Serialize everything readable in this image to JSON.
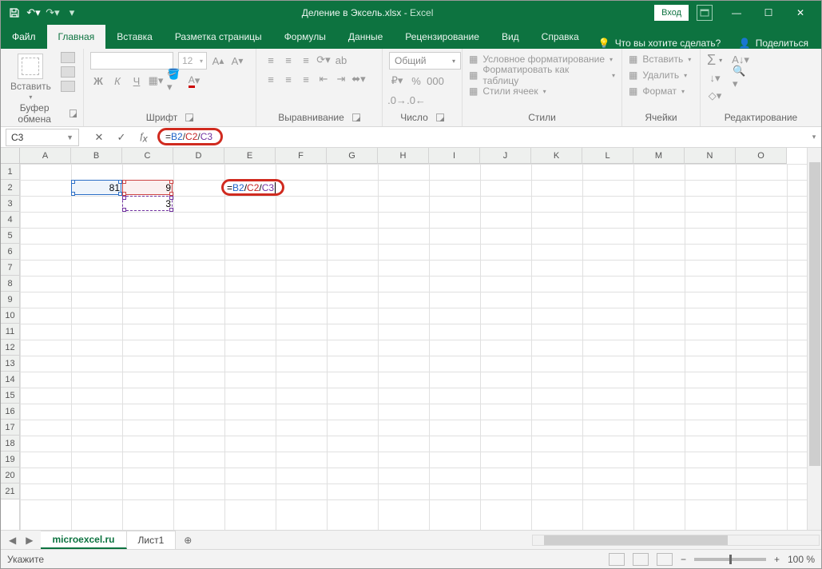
{
  "title": {
    "doc": "Деление в Эксель.xlsx",
    "sep": " - ",
    "app": "Excel"
  },
  "signin": "Вход",
  "tabs": {
    "file": "Файл",
    "home": "Главная",
    "insert": "Вставка",
    "layout": "Разметка страницы",
    "formulas": "Формулы",
    "data": "Данные",
    "review": "Рецензирование",
    "view": "Вид",
    "help": "Справка",
    "tell": "Что вы хотите сделать?",
    "share": "Поделиться"
  },
  "groups": {
    "clipboard": "Буфер обмена",
    "font": "Шрифт",
    "align": "Выравнивание",
    "number": "Число",
    "styles": "Стили",
    "cells": "Ячейки",
    "editing": "Редактирование"
  },
  "clipboard": {
    "paste": "Вставить"
  },
  "font": {
    "size": "12",
    "bold": "Ж",
    "italic": "К",
    "underline": "Ч"
  },
  "number": {
    "format": "Общий"
  },
  "styles": {
    "cond": "Условное форматирование",
    "table": "Форматировать как таблицу",
    "cell": "Стили ячеек"
  },
  "cells": {
    "insert": "Вставить",
    "delete": "Удалить",
    "format": "Формат"
  },
  "namebox": "C3",
  "formula": {
    "eq": "=",
    "b2": "B2",
    "s1": "/",
    "c2": "C2",
    "s2": "/",
    "c3": "C3"
  },
  "columns": [
    "A",
    "B",
    "C",
    "D",
    "E",
    "F",
    "G",
    "H",
    "I",
    "J",
    "K",
    "L",
    "M",
    "N",
    "O"
  ],
  "rows": [
    "1",
    "2",
    "3",
    "4",
    "5",
    "6",
    "7",
    "8",
    "9",
    "10",
    "11",
    "12",
    "13",
    "14",
    "15",
    "16",
    "17",
    "18",
    "19",
    "20",
    "21"
  ],
  "cellsData": {
    "B2": "81",
    "C2": "9",
    "C3": "3"
  },
  "sheets": {
    "s1": "microexcel.ru",
    "s2": "Лист1"
  },
  "status": {
    "mode": "Укажите",
    "zoom": "100 %"
  }
}
